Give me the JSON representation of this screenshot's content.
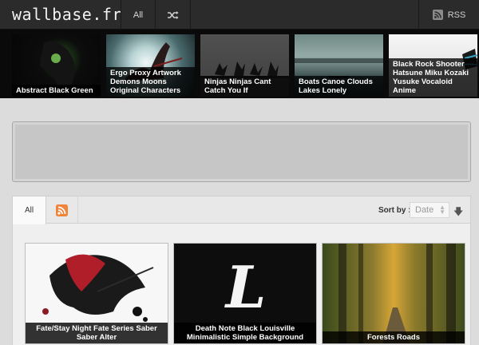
{
  "header": {
    "logo": "wallbase.fr",
    "nav_all": "All",
    "rss_label": "RSS"
  },
  "featured": [
    {
      "caption": "Abstract Black Green"
    },
    {
      "caption": "Ergo Proxy Artwork Demons Moons Original Characters"
    },
    {
      "caption": "Ninjas Ninjas Cant Catch You If"
    },
    {
      "caption": "Boats Canoe Clouds Lakes Lonely"
    },
    {
      "caption": "Black Rock Shooter Hatsune Miku Kozaki Yusuke Vocaloid Anime"
    }
  ],
  "main": {
    "tab_all": "All",
    "sort_label": "Sort by :",
    "sort_value": "Date"
  },
  "wallpapers": [
    {
      "caption": "Fate/Stay Night Fate Series Saber Saber Alter"
    },
    {
      "caption": "Death Note Black Louisville Minimalistic Simple Background",
      "glyph": "L"
    },
    {
      "caption": "Forests Roads"
    }
  ],
  "colors": {
    "topbar": "#2b2b2b",
    "rss_accent": "#f0853a",
    "page_bg": "#dcdcdc"
  }
}
